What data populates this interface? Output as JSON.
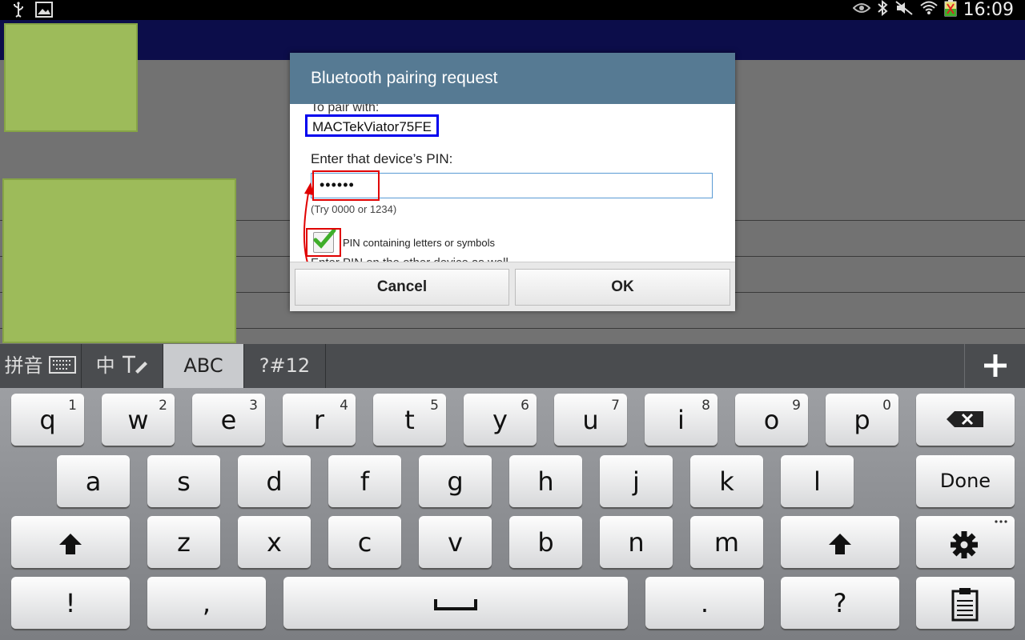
{
  "status_bar": {
    "time": "16:09",
    "left_icons": [
      "usb-icon",
      "image-icon"
    ],
    "right_icons": [
      "eye-icon",
      "bluetooth-icon",
      "mute-icon",
      "wifi-icon",
      "battery-icon"
    ]
  },
  "dialog": {
    "title": "Bluetooth pairing request",
    "pair_with_label": "To pair with:",
    "device_name": "MACTekViator75FE",
    "enter_pin_label": "Enter that device’s PIN:",
    "pin_value": "••••••",
    "pin_hint": "(Try 0000 or 1234)",
    "checkbox_label": "PIN containing letters or symbols",
    "checkbox_checked": true,
    "cut_text": "Enter PIN on the other device as well.",
    "cancel_label": "Cancel",
    "ok_label": "OK"
  },
  "keyboard": {
    "tabs": [
      {
        "label": "拼音",
        "icon": "keyboard-icon"
      },
      {
        "label": "中",
        "icon": "handwriting-icon"
      },
      {
        "label": "ABC",
        "active": true
      },
      {
        "label": "?#12"
      }
    ],
    "plus_icon": "plus-icon",
    "row1": [
      {
        "key": "q",
        "sup": "1"
      },
      {
        "key": "w",
        "sup": "2"
      },
      {
        "key": "e",
        "sup": "3"
      },
      {
        "key": "r",
        "sup": "4"
      },
      {
        "key": "t",
        "sup": "5"
      },
      {
        "key": "y",
        "sup": "6"
      },
      {
        "key": "u",
        "sup": "7"
      },
      {
        "key": "i",
        "sup": "8"
      },
      {
        "key": "o",
        "sup": "9"
      },
      {
        "key": "p",
        "sup": "0"
      }
    ],
    "row2": [
      "a",
      "s",
      "d",
      "f",
      "g",
      "h",
      "j",
      "k",
      "l"
    ],
    "row3": [
      "z",
      "x",
      "c",
      "v",
      "b",
      "n",
      "m"
    ],
    "done_label": "Done",
    "row4": {
      "exclaim": "!",
      "comma": ",",
      "period": ".",
      "question": "?"
    },
    "icons": {
      "backspace": "backspace-icon",
      "shift": "shift-icon",
      "settings": "gear-icon",
      "space": "space-icon",
      "clipboard": "clipboard-icon"
    }
  },
  "colors": {
    "dialog_title_bg": "#567a93",
    "app_header_bg": "#0c0d4a",
    "tile_green": "#9dbb5a",
    "highlight_red": "#e00000",
    "highlight_blue": "#0000ee",
    "checkmark_green": "#3fae2a"
  }
}
